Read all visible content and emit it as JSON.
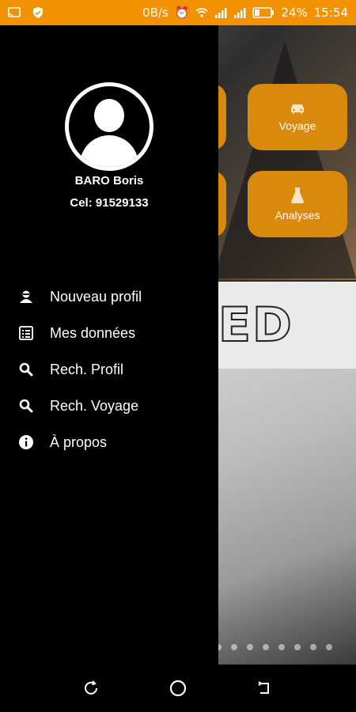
{
  "status_bar": {
    "speed": "0B/s",
    "battery": "24%",
    "time": "15:54"
  },
  "drawer": {
    "user_name": "BARO Boris",
    "user_phone": "Cel: 91529133",
    "menu": [
      {
        "label": "Nouveau profil",
        "icon": "user-icon"
      },
      {
        "label": "Mes données",
        "icon": "list-icon"
      },
      {
        "label": "Rech. Profil",
        "icon": "search-icon"
      },
      {
        "label": "Rech. Voyage",
        "icon": "search-icon"
      },
      {
        "label": "À propos",
        "icon": "info-icon"
      }
    ]
  },
  "background": {
    "tiles": [
      {
        "label": "Voyage",
        "icon": "car-icon"
      },
      {
        "label": "Analyses",
        "icon": "flask-icon"
      }
    ],
    "banner_text": "ED",
    "accent_color": "#d98a0c"
  },
  "nav": {
    "buttons": [
      "recent-apps-icon",
      "home-icon",
      "back-icon"
    ]
  }
}
